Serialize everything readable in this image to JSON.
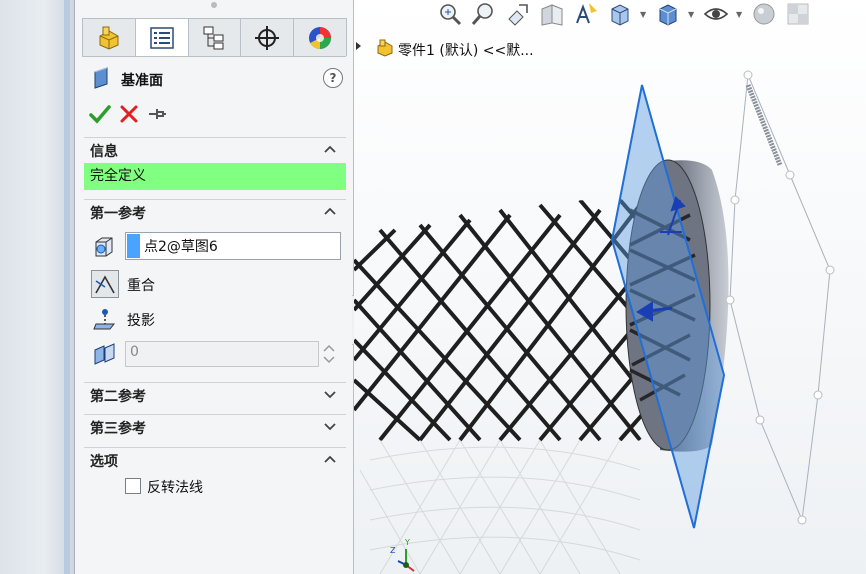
{
  "feature_manager": {
    "tabs": [
      {
        "name": "feature-tree",
        "icon": "part-icon"
      },
      {
        "name": "property-manager",
        "icon": "property-list-icon"
      },
      {
        "name": "configuration-manager",
        "icon": "configuration-icon"
      },
      {
        "name": "dimxpert-manager",
        "icon": "crosshair-icon"
      },
      {
        "name": "display-manager",
        "icon": "appearance-icon"
      }
    ]
  },
  "property_manager": {
    "title": "基准面",
    "help_icon": "help-icon",
    "help_text": "?",
    "actions": {
      "ok": "confirm-icon",
      "cancel": "cancel-icon",
      "pin": "pin-icon"
    },
    "sections": {
      "info": {
        "label": "信息",
        "status": "完全定义",
        "status_color": "#80ff80"
      },
      "first_reference": {
        "label": "第一参考",
        "value": "点2@草图6",
        "options": [
          {
            "label": "重合",
            "active": true
          },
          {
            "label": "投影",
            "active": false
          }
        ],
        "offset_value": "0"
      },
      "second_reference": {
        "label": "第二参考"
      },
      "third_reference": {
        "label": "第三参考"
      },
      "options": {
        "label": "选项",
        "flip_normal_label": "反转法线",
        "flip_normal_checked": false
      }
    }
  },
  "graphics": {
    "breadcrumb": "零件1 (默认) <<默...",
    "toolbar_icons": [
      "zoom-to-fit-icon",
      "zoom-to-area-icon",
      "previous-view-icon",
      "section-view-icon",
      "dynamic-annotation-icon",
      "view-orientation-icon",
      "display-style-icon",
      "hide-show-icon",
      "edit-appearance-icon",
      "apply-scene-icon"
    ],
    "triad": {
      "x": "X",
      "y": "Y",
      "z": "Z"
    },
    "colors": {
      "plane": "#1f6fd6",
      "plane_fill": "#5d9be0",
      "status_green": "#80ff80"
    }
  }
}
